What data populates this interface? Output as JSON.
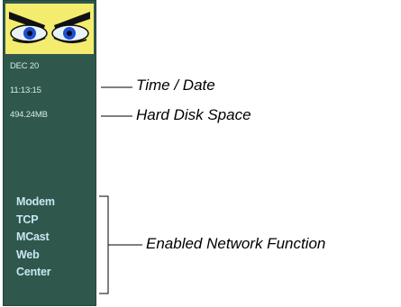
{
  "sidebar": {
    "logo_icon": "eyes-icon",
    "date": "DEC 20",
    "time": "11:13:15",
    "disk": "494.24MB",
    "functions": [
      "Modem",
      "TCP",
      "MCast",
      "Web",
      "Center"
    ]
  },
  "callouts": {
    "time_date": "Time / Date",
    "disk_space": "Hard Disk Space",
    "network": "Enabled Network Function"
  },
  "colors": {
    "panel": "#2f574c",
    "logo_background": "#f4ec6e",
    "function_text": "#c9e6f4",
    "readout_text": "#d7ece4"
  }
}
